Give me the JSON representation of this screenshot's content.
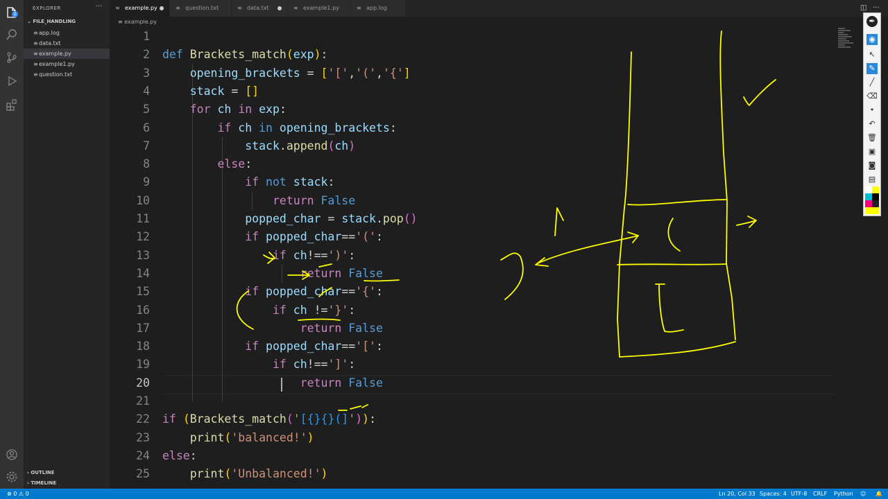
{
  "sidebar": {
    "title": "EXPLORER",
    "folder": "FILE_HANDLING",
    "files": [
      {
        "name": "app.log",
        "icon": "≡"
      },
      {
        "name": "data.txt",
        "icon": "≡"
      },
      {
        "name": "example.py",
        "icon": "≡"
      },
      {
        "name": "example1.py",
        "icon": "≡"
      },
      {
        "name": "question.txt",
        "icon": "≡"
      }
    ],
    "outline": "OUTLINE",
    "timeline": "TIMELINE"
  },
  "tabs": [
    {
      "label": "example.py"
    },
    {
      "label": "question.txt"
    },
    {
      "label": "data.txt"
    },
    {
      "label": "example1.py"
    },
    {
      "label": "app.log"
    }
  ],
  "breadcrumb": "example.py",
  "line_numbers": [
    "1",
    "2",
    "3",
    "4",
    "5",
    "6",
    "7",
    "8",
    "9",
    "10",
    "11",
    "12",
    "13",
    "14",
    "15",
    "16",
    "17",
    "18",
    "19",
    "20",
    "21",
    "22",
    "23",
    "24",
    "25"
  ],
  "status": {
    "problems": "⊗ 0 ⚠ 0",
    "position": "Ln 20, Col 33",
    "spaces": "Spaces: 4",
    "encoding": "UTF-8",
    "eol": "CRLF",
    "language": "Python"
  },
  "colors": {
    "accent": "#007acc",
    "ink": "#ffff00"
  }
}
